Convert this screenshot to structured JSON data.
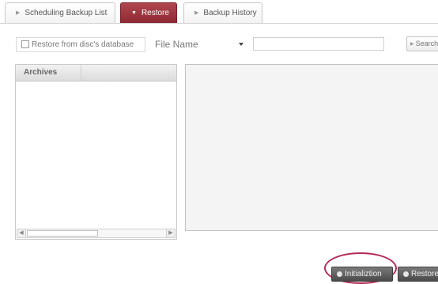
{
  "tabs": [
    {
      "label": "Scheduling Backup List",
      "active": false
    },
    {
      "label": "Restore",
      "active": true
    },
    {
      "label": "Backup History",
      "active": false
    }
  ],
  "toolbar": {
    "restore_from_disc_label": "Restore from disc's database",
    "restore_from_disc_checked": false,
    "search_by_selected": "File Name",
    "search_input_value": "",
    "search_button_label": "Search"
  },
  "archives": {
    "header": "Archives",
    "items": []
  },
  "buttons": {
    "initialization_label": "Initializtion",
    "restore_label": "Restore"
  },
  "colors": {
    "active_tab": "#8e2832",
    "highlight_circle": "#b32a55",
    "dark_button": "#4a4a4a"
  }
}
